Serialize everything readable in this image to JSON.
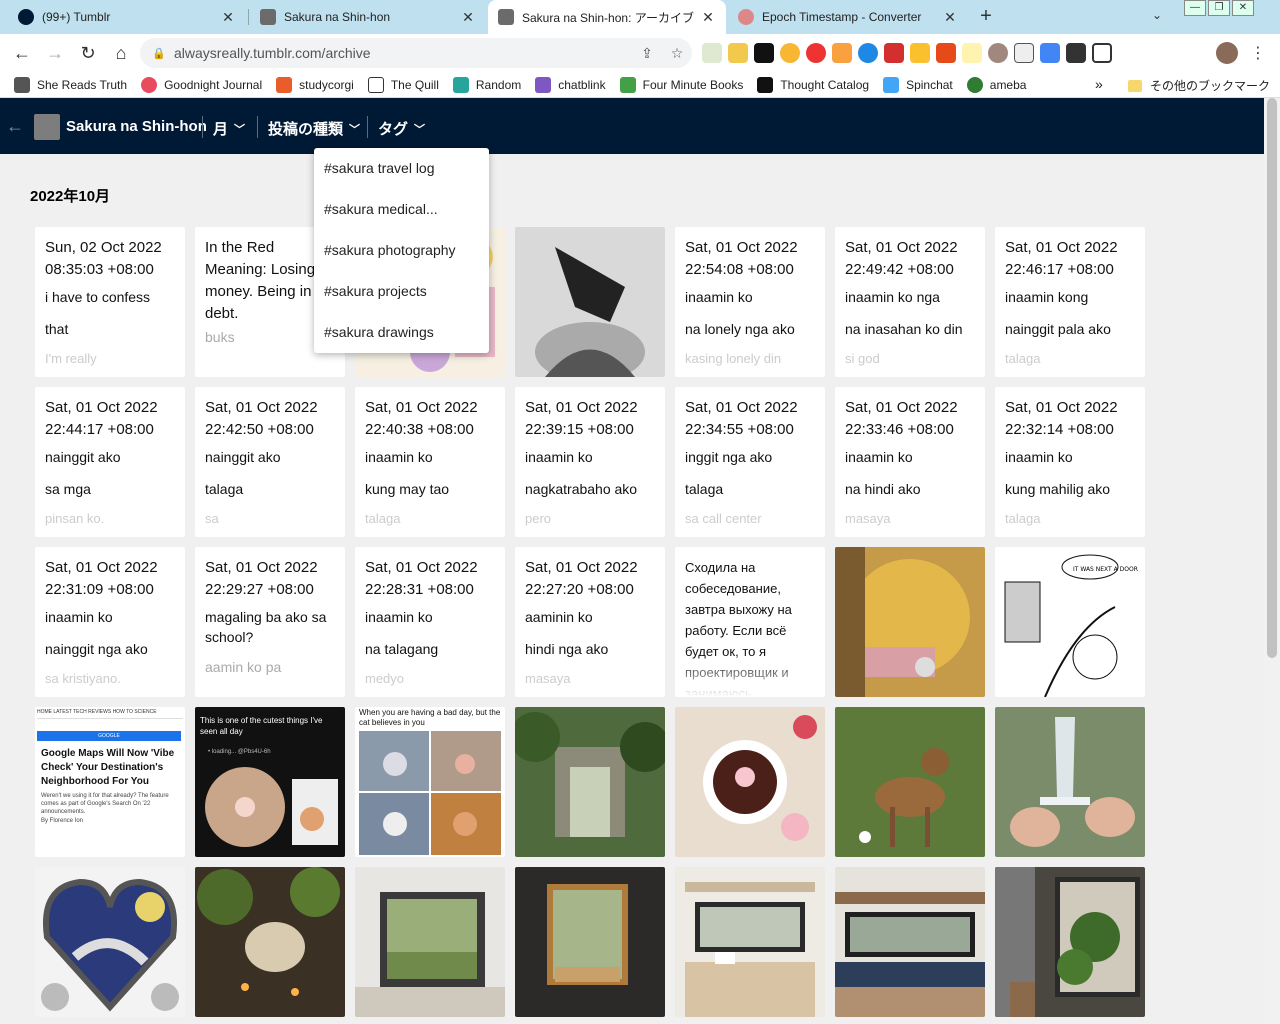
{
  "browser": {
    "tabs": [
      {
        "title": "(99+) Tumblr"
      },
      {
        "title": "Sakura na Shin-hon"
      },
      {
        "title": "Sakura na Shin-hon: アーカイブ"
      },
      {
        "title": "Epoch Timestamp - Converter"
      }
    ],
    "url": "alwaysreally.tumblr.com/archive",
    "bookmarks": [
      "She Reads Truth",
      "Goodnight Journal",
      "studycorgi",
      "The Quill",
      "Random",
      "chatblink",
      "Four Minute Books",
      "Thought Catalog",
      "Spinchat",
      "ameba"
    ],
    "bookmarks_more": "»",
    "other_bookmarks": "その他のブックマーク"
  },
  "tumblr": {
    "blog_title": "Sakura na Shin-hon",
    "nav_month": "月",
    "nav_post_type": "投稿の種類",
    "nav_tags": "タグ"
  },
  "archive": {
    "month_label": "2022年10月",
    "dropdown_items": [
      "#sakura travel log",
      "#sakura medical...",
      "#sakura photography",
      "#sakura projects",
      "#sakura drawings"
    ],
    "cards": [
      {
        "type": "text",
        "l1": "Sun, 02 Oct 2022 08:35:03 +08:00",
        "l2": "i have to confess",
        "l3": "that",
        "l4": "I'm really"
      },
      {
        "type": "multi",
        "body": "In the Red Meaning: Losing money. Being in debt.",
        "sub": "buks"
      },
      {
        "type": "image",
        "desc": "colorful illustration"
      },
      {
        "type": "image",
        "desc": "crow drawing"
      },
      {
        "type": "text",
        "l1": "Sat, 01 Oct 2022 22:54:08 +08:00",
        "l2": "inaamin ko",
        "l3": "na lonely nga ako",
        "l4": "kasing lonely din"
      },
      {
        "type": "text",
        "l1": "Sat, 01 Oct 2022 22:49:42 +08:00",
        "l2": "inaamin ko nga",
        "l3": "na inasahan ko din",
        "l4": "si god"
      },
      {
        "type": "text",
        "l1": "Sat, 01 Oct 2022 22:46:17 +08:00",
        "l2": "inaamin kong",
        "l3": "nainggit pala ako",
        "l4": "talaga"
      },
      {
        "type": "text",
        "l1": "Sat, 01 Oct 2022 22:44:17 +08:00",
        "l2": "nainggit ako",
        "l3": "sa mga",
        "l4": "pinsan ko."
      },
      {
        "type": "text",
        "l1": "Sat, 01 Oct 2022 22:42:50 +08:00",
        "l2": "nainggit ako",
        "l3": "talaga",
        "l4": "sa"
      },
      {
        "type": "text",
        "l1": "Sat, 01 Oct 2022 22:40:38 +08:00",
        "l2": "inaamin ko",
        "l3": "kung may tao",
        "l4": "talaga"
      },
      {
        "type": "text",
        "l1": "Sat, 01 Oct 2022 22:39:15 +08:00",
        "l2": "inaamin ko",
        "l3": "nagkatrabaho ako",
        "l4": "pero"
      },
      {
        "type": "text",
        "l1": "Sat, 01 Oct 2022 22:34:55 +08:00",
        "l2": "inggit nga ako",
        "l3": "talaga",
        "l4": "sa call center"
      },
      {
        "type": "text",
        "l1": "Sat, 01 Oct 2022 22:33:46 +08:00",
        "l2": "inaamin ko",
        "l3": "na hindi ako",
        "l4": "masaya"
      },
      {
        "type": "text",
        "l1": "Sat, 01 Oct 2022 22:32:14 +08:00",
        "l2": "inaamin ko",
        "l3": "kung mahilig ako",
        "l4": "talaga"
      },
      {
        "type": "text",
        "l1": "Sat, 01 Oct 2022 22:31:09 +08:00",
        "l2": "inaamin ko",
        "l3": "nainggit nga ako",
        "l4": "sa kristiyano."
      },
      {
        "type": "multi2",
        "l1": "Sat, 01 Oct 2022 22:29:27 +08:00",
        "body": "magaling ba ako sa school?",
        "sub": "aamin ko pa"
      },
      {
        "type": "text",
        "l1": "Sat, 01 Oct 2022 22:28:31 +08:00",
        "l2": "inaamin ko",
        "l3": "na talagang",
        "l4": "medyo"
      },
      {
        "type": "text",
        "l1": "Sat, 01 Oct 2022 22:27:20 +08:00",
        "l2": "aaminin ko",
        "l3": "hindi nga ako",
        "l4": "masaya"
      },
      {
        "type": "ru",
        "body": "Сходила на собеседование, завтра выхожу на работу. Если всё будет ок, то я проектировщик и занимаюсь"
      },
      {
        "type": "image",
        "desc": "hobbit-style room"
      },
      {
        "type": "image",
        "desc": "comic drawing"
      },
      {
        "type": "image",
        "desc": "Google Maps article"
      },
      {
        "type": "image",
        "desc": "cat paw video"
      },
      {
        "type": "image",
        "desc": "cat meme grid"
      },
      {
        "type": "image",
        "desc": "overgrown ruin"
      },
      {
        "type": "image",
        "desc": "tea and flowers"
      },
      {
        "type": "image",
        "desc": "fawn in meadow"
      },
      {
        "type": "image",
        "desc": "glass dagger"
      },
      {
        "type": "image",
        "desc": "stained glass heart"
      },
      {
        "type": "image",
        "desc": "cozy plant room"
      },
      {
        "type": "image",
        "desc": "window nook"
      },
      {
        "type": "image",
        "desc": "window seat"
      },
      {
        "type": "image",
        "desc": "window bench"
      },
      {
        "type": "image",
        "desc": "window daybed"
      },
      {
        "type": "image",
        "desc": "plants by window"
      }
    ],
    "image_text": {
      "maps_nav": "HOME  LATEST  TECH  REVIEWS  HOW TO  SCIENCE",
      "maps_badge": "GOOGLE",
      "maps_headline": "Google Maps Will Now 'Vibe Check' Your Destination's Neighborhood For You",
      "maps_sub": "Weren't we using it for that already? The feature comes as part of Google's Search On '22 announcements.",
      "maps_byline": "By Florence Ion",
      "cat_video_caption": "This is one of the cutest things I've seen all day",
      "cat_video_loading": "• loading... @Pbs4U-6h",
      "cat_meme_caption": "When you are having a bad day, but the cat believes in you",
      "comic_bubble": "IT WAS NEXT A DOOR"
    }
  }
}
